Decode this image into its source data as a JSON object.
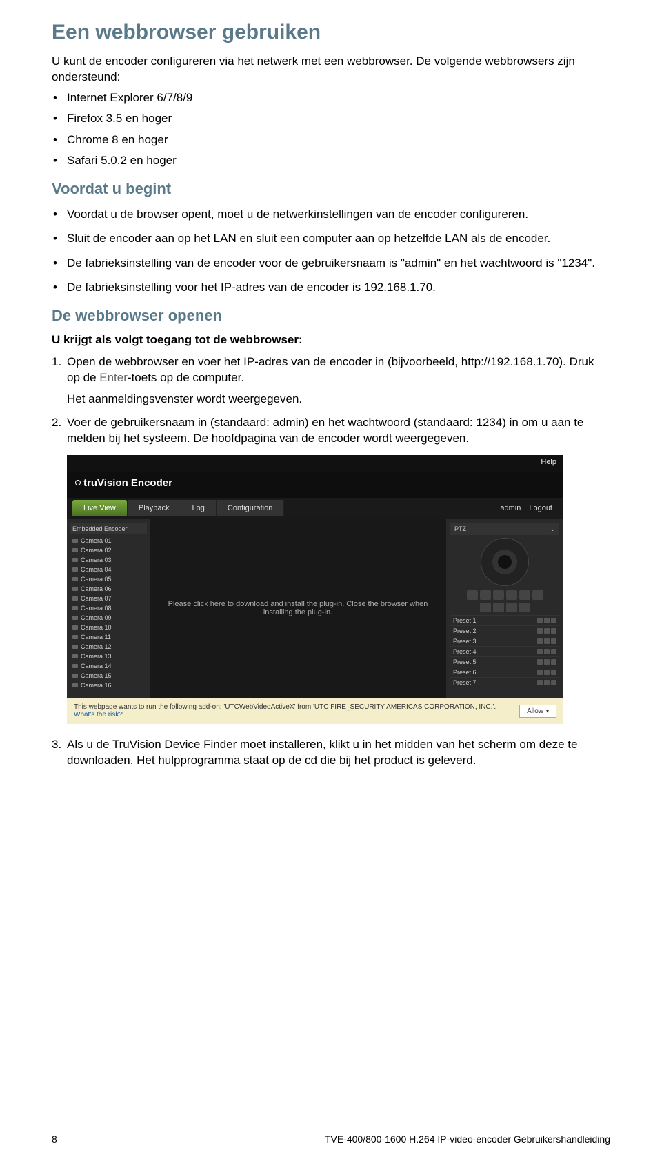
{
  "h1": "Een webbrowser gebruiken",
  "p1": "U kunt de encoder configureren via het netwerk met een webbrowser. De volgende webbrowsers zijn ondersteund:",
  "list1": [
    "Internet Explorer 6/7/8/9",
    "Firefox 3.5 en hoger",
    "Chrome 8 en hoger",
    "Safari 5.0.2 en hoger"
  ],
  "h2a": "Voordat u begint",
  "list2": [
    "Voordat u de browser opent, moet u de netwerkinstellingen van de encoder configureren.",
    "Sluit de encoder aan op het LAN en sluit een computer aan op hetzelfde LAN als de encoder.",
    "De fabrieksinstelling van de encoder voor de gebruikersnaam is \"admin\" en het wachtwoord is \"1234\".",
    "De fabrieksinstelling voor het IP-adres van de encoder is 192.168.1.70."
  ],
  "h2b": "De webbrowser openen",
  "bold1": "U krijgt als volgt toegang tot de webbrowser:",
  "step1_a": "Open de webbrowser en voer het IP-adres van de encoder in (bijvoorbeeld, http://192.168.1.70). Druk op de ",
  "step1_gray": "Enter",
  "step1_b": "-toets op de computer.",
  "step1_sub": "Het aanmeldingsvenster wordt weergegeven.",
  "step2": "Voer de gebruikersnaam in (standaard: admin) en het wachtwoord (standaard: 1234) in om u aan te melden bij het systeem. De hoofdpagina van de encoder wordt weergegeven.",
  "step3": "Als u de TruVision Device Finder moet installeren, klikt u in het midden van het scherm om deze te downloaden. Het hulpprogramma staat op de cd die bij het product is geleverd.",
  "screenshot": {
    "help": "Help",
    "brand": "truVision Encoder",
    "nav": {
      "live": "Live View",
      "playback": "Playback",
      "log": "Log",
      "config": "Configuration",
      "user": "admin",
      "logout": "Logout"
    },
    "sidebar_head": "Embedded Encoder",
    "cams": [
      "Camera 01",
      "Camera 02",
      "Camera 03",
      "Camera 04",
      "Camera 05",
      "Camera 06",
      "Camera 07",
      "Camera 08",
      "Camera 09",
      "Camera 10",
      "Camera 11",
      "Camera 12",
      "Camera 13",
      "Camera 14",
      "Camera 15",
      "Camera 16"
    ],
    "plugin_msg": "Please click here to download and install the plug-in. Close the browser when installing the plug-in.",
    "ptz_label": "PTZ",
    "presets": [
      "Preset 1",
      "Preset 2",
      "Preset 3",
      "Preset 4",
      "Preset 5",
      "Preset 6",
      "Preset 7"
    ],
    "infobar_text": "This webpage wants to run the following add-on: 'UTCWebVideoActiveX' from 'UTC FIRE_SECURITY AMERICAS CORPORATION, INC.'.",
    "infobar_risk": "What's the risk?",
    "allow": "Allow"
  },
  "footer": {
    "page": "8",
    "doc": "TVE-400/800-1600 H.264 IP-video-encoder Gebruikershandleiding"
  }
}
